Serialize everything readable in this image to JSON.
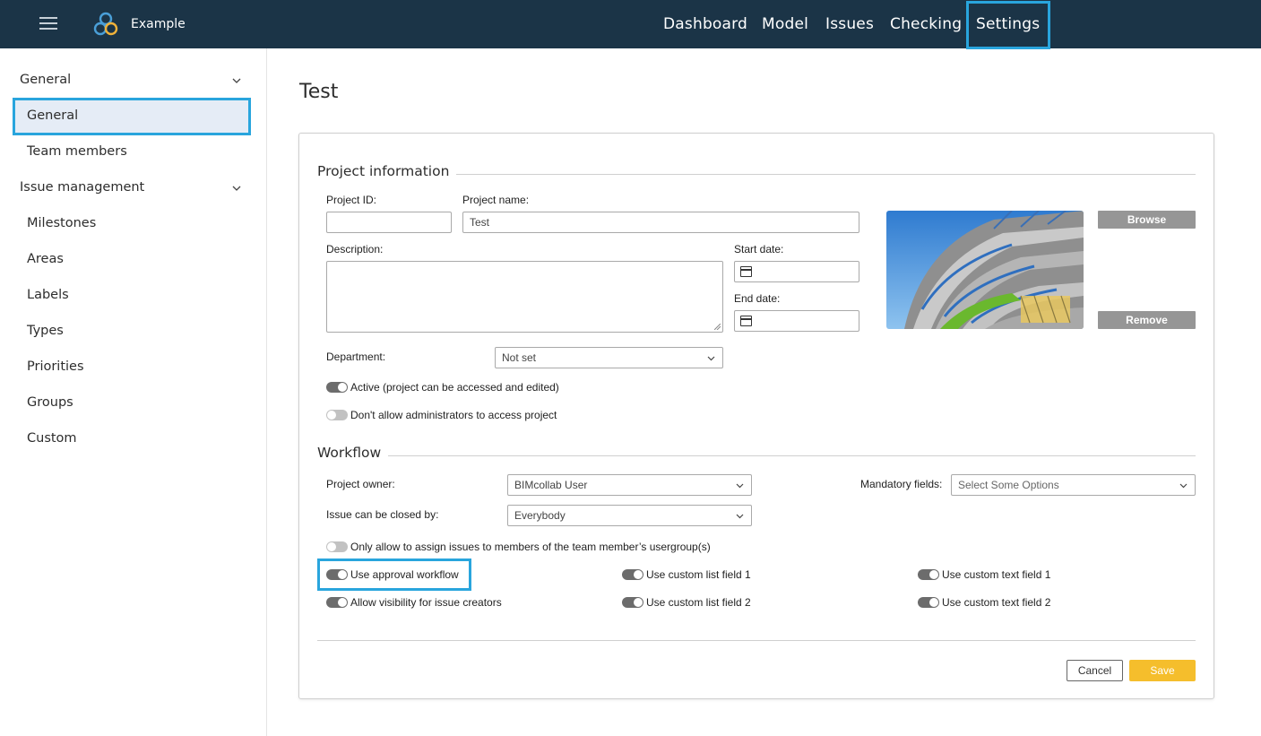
{
  "header": {
    "app_title": "Example",
    "nav": [
      "Dashboard",
      "Model",
      "Issues",
      "Checking",
      "Settings"
    ],
    "active_nav": "Settings",
    "colors": {
      "bar": "#1b3447",
      "highlight": "#29a5dd"
    }
  },
  "sidebar": {
    "groups": [
      {
        "label": "General",
        "items": [
          "General",
          "Team members"
        ]
      },
      {
        "label": "Issue management",
        "items": [
          "Milestones",
          "Areas",
          "Labels",
          "Types",
          "Priorities",
          "Groups",
          "Custom"
        ]
      }
    ],
    "active_item": "General"
  },
  "page": {
    "title": "Test"
  },
  "project_info": {
    "section_title": "Project information",
    "project_id_label": "Project ID:",
    "project_id_value": "",
    "project_name_label": "Project name:",
    "project_name_value": "Test",
    "description_label": "Description:",
    "description_value": "",
    "start_date_label": "Start date:",
    "start_date_value": "",
    "end_date_label": "End date:",
    "end_date_value": "",
    "department_label": "Department:",
    "department_value": "Not set",
    "browse_label": "Browse",
    "remove_label": "Remove",
    "toggles": [
      {
        "label": "Active (project can be accessed and edited)",
        "on": true
      },
      {
        "label": "Don't allow administrators to access project",
        "on": false
      }
    ]
  },
  "workflow": {
    "section_title": "Workflow",
    "owner_label": "Project owner:",
    "owner_value": "BIMcollab User",
    "closed_by_label": "Issue can be closed by:",
    "closed_by_value": "Everybody",
    "mandatory_label": "Mandatory fields:",
    "mandatory_placeholder": "Select Some Options",
    "toggles": {
      "assign_usergroup": {
        "label": "Only allow to assign issues to members of the team member’s usergroup(s)",
        "on": false
      },
      "approval_workflow": {
        "label": "Use approval workflow",
        "on": true
      },
      "visibility_creators": {
        "label": "Allow visibility for issue creators",
        "on": true
      },
      "custom_list_1": {
        "label": "Use custom list field 1",
        "on": true
      },
      "custom_list_2": {
        "label": "Use custom list field 2",
        "on": true
      },
      "custom_text_1": {
        "label": "Use custom text field 1",
        "on": true
      },
      "custom_text_2": {
        "label": "Use custom text field 2",
        "on": true
      }
    }
  },
  "footer": {
    "cancel_label": "Cancel",
    "save_label": "Save",
    "save_color": "#f5be2c"
  }
}
